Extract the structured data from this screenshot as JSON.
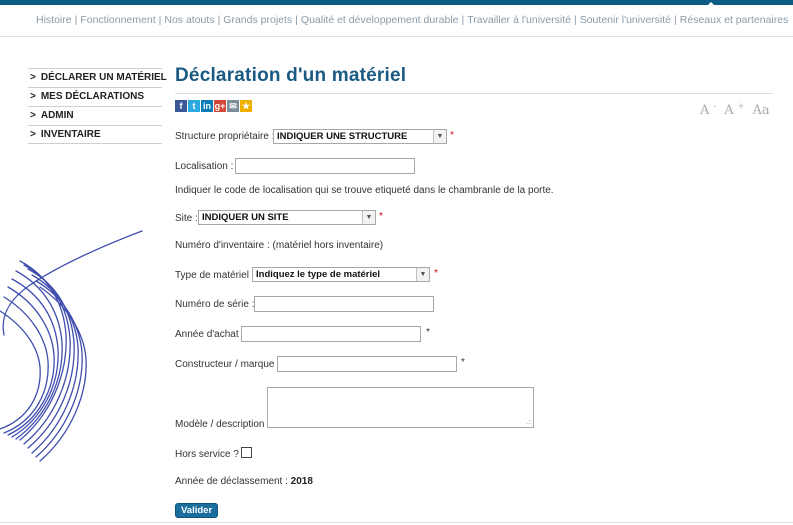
{
  "topnav": {
    "items": [
      "Histoire",
      "Fonctionnement",
      "Nos atouts",
      "Grands projets",
      "Qualité et développement durable",
      "Travailler à l'université",
      "Soutenir l'université",
      "Réseaux et partenaires"
    ],
    "separator": "|"
  },
  "sidebar": {
    "chevron": ">",
    "items": [
      {
        "label": "DÉCLARER UN MATÉRIEL"
      },
      {
        "label": "MES DÉCLARATIONS"
      },
      {
        "label": "ADMIN"
      },
      {
        "label": "INVENTAIRE"
      }
    ]
  },
  "page": {
    "title": "Déclaration d'un matériel"
  },
  "share": {
    "icons": [
      "facebook-icon",
      "twitter-icon",
      "linkedin-icon",
      "google-plus-icon",
      "email-icon",
      "favorite-icon"
    ],
    "glyphs": [
      "f",
      "t",
      "in",
      "g+",
      "✉",
      "★"
    ]
  },
  "fontsize": {
    "decrease": "A",
    "decrease_sup": "-",
    "increase": "A",
    "increase_sup": "+",
    "reset": "Aa"
  },
  "form": {
    "structure_label": "Structure propriétaire :",
    "structure_value": "INDIQUER UNE STRUCTURE",
    "localisation_label": "Localisation :",
    "localisation_value": "",
    "localisation_help": "Indiquer le code de localisation qui se trouve etiqueté dans le chambranle de la porte.",
    "site_label": "Site :",
    "site_value": "INDIQUER UN SITE",
    "inventaire_text": "Numéro d'inventaire : (matériel hors inventaire)",
    "type_label": "Type de matériel :",
    "type_value": "Indiquez le type de matériel",
    "serie_label": "Numéro de série :",
    "serie_value": "",
    "annee_label": "Année d'achat :",
    "annee_value": "",
    "constructeur_label": "Constructeur / marque :",
    "constructeur_value": "",
    "modele_label": "Modèle / description :",
    "modele_value": "",
    "hors_service_label": "Hors service ?",
    "hors_service_checked": false,
    "declassement_label": "Année de déclassement :",
    "declassement_value": "2018",
    "required_mark": "*",
    "submit_label": "Valider"
  },
  "colors": {
    "brand": "#0d5c86",
    "title": "#1a5a83",
    "required": "#d0021b",
    "button": "#1a6e9c",
    "scribble": "#2b3aa6"
  }
}
